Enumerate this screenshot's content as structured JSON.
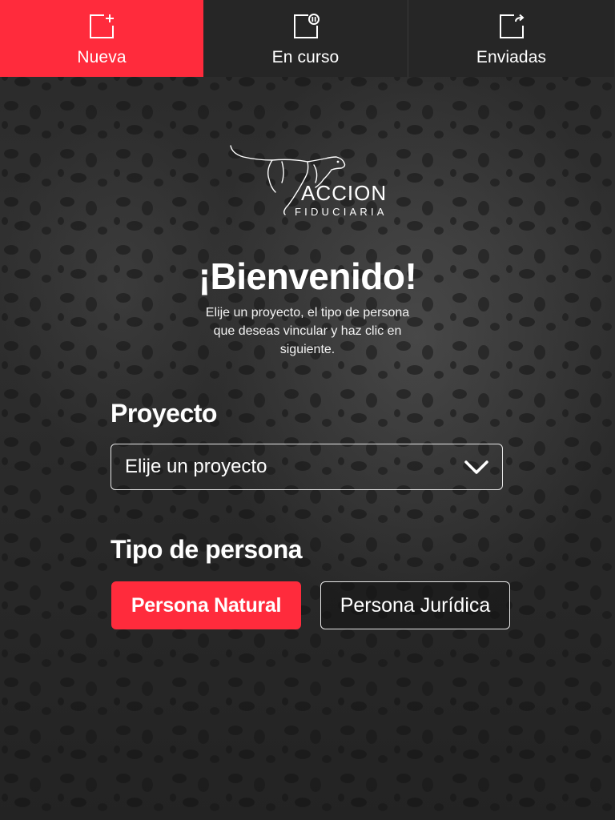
{
  "tabs": [
    {
      "label": "Nueva",
      "icon": "new-document-icon",
      "active": true
    },
    {
      "label": "En curso",
      "icon": "paused-document-icon",
      "active": false
    },
    {
      "label": "Enviadas",
      "icon": "sent-document-icon",
      "active": false
    }
  ],
  "logo": {
    "name_line1": "ACCION",
    "name_line2": "FIDUCIARIA",
    "icon": "cheetah-logo-icon"
  },
  "welcome": {
    "title": "¡Bienvenido!",
    "subtitle": "Elije un proyecto, el tipo de persona que deseas vincular y haz clic en siguiente."
  },
  "form": {
    "project_label": "Proyecto",
    "project_select_value": "Elije un proyecto",
    "person_type_label": "Tipo de persona",
    "person_options": [
      {
        "label": "Persona Natural",
        "selected": true
      },
      {
        "label": "Persona Jurídica",
        "selected": false
      }
    ]
  },
  "colors": {
    "accent": "#ff2b3c",
    "tab_inactive": "#262626",
    "background": "#2b2b2b"
  }
}
